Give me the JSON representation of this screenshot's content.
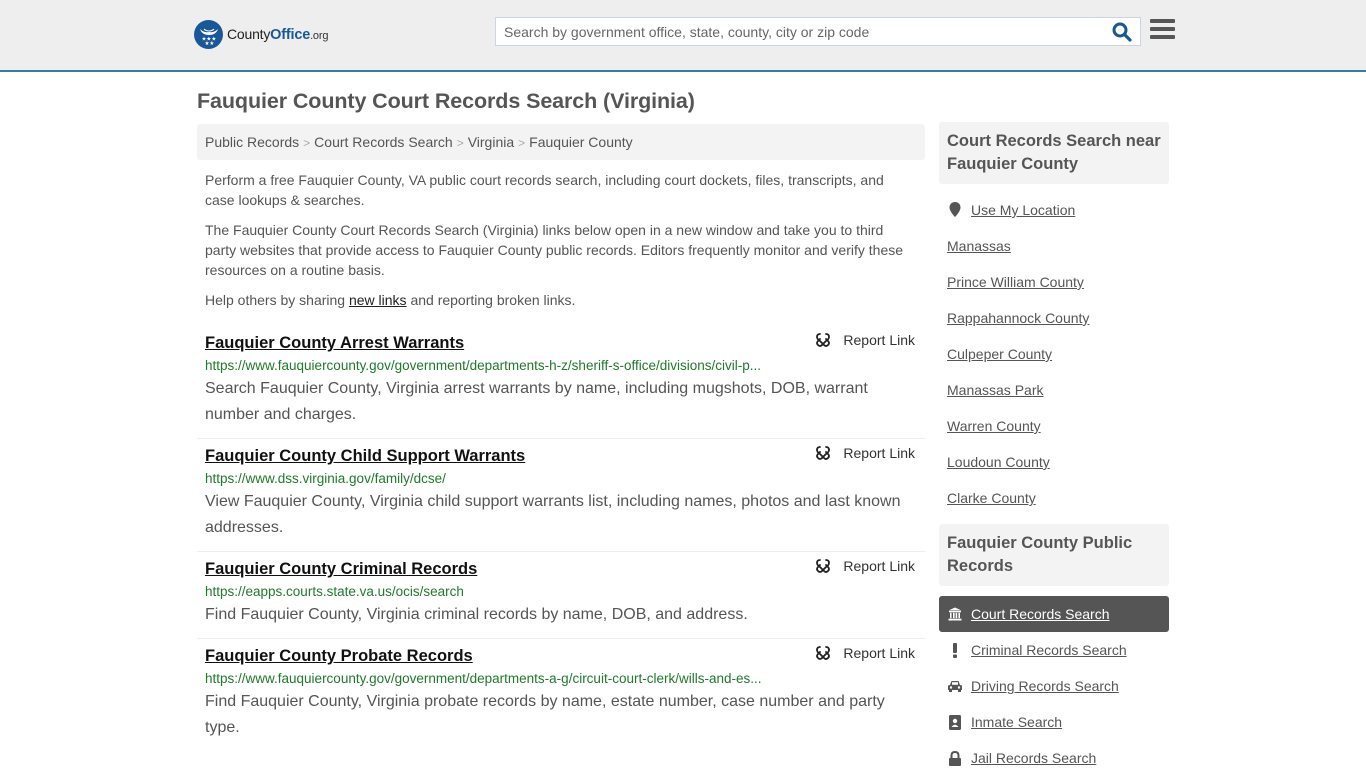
{
  "header": {
    "logo": {
      "name": "County",
      "accent": "Office",
      "tld": ".org"
    },
    "search": {
      "placeholder": "Search by government office, state, county, city or zip code",
      "value": ""
    },
    "colors": {
      "brand": "#1a5799",
      "header_bg": "#eeeeee",
      "header_border": "#3b78aa"
    }
  },
  "page": {
    "title": "Fauquier County Court Records Search (Virginia)",
    "breadcrumb": [
      "Public Records",
      "Court Records Search",
      "Virginia",
      "Fauquier County"
    ],
    "breadcrumb_separator": ">",
    "intro": {
      "p1": "Perform a free Fauquier County, VA public court records search, including court dockets, files, transcripts, and case lookups & searches.",
      "p2": "The Fauquier County Court Records Search (Virginia) links below open in a new window and take you to third party websites that provide access to Fauquier County public records. Editors frequently monitor and verify these resources on a routine basis.",
      "p3_before": "Help others by sharing ",
      "p3_link": "new links",
      "p3_after": " and reporting broken links."
    }
  },
  "results": [
    {
      "title": "Fauquier County Arrest Warrants",
      "url": "https://www.fauquiercounty.gov/government/departments-h-z/sheriff-s-office/divisions/civil-p...",
      "description": "Search Fauquier County, Virginia arrest warrants by name, including mugshots, DOB, warrant number and charges.",
      "report_label": "Report Link"
    },
    {
      "title": "Fauquier County Child Support Warrants",
      "url": "https://www.dss.virginia.gov/family/dcse/",
      "description": "View Fauquier County, Virginia child support warrants list, including names, photos and last known addresses.",
      "report_label": "Report Link"
    },
    {
      "title": "Fauquier County Criminal Records",
      "url": "https://eapps.courts.state.va.us/ocis/search",
      "description": "Find Fauquier County, Virginia criminal records by name, DOB, and address.",
      "report_label": "Report Link"
    },
    {
      "title": "Fauquier County Probate Records",
      "url": "https://www.fauquiercounty.gov/government/departments-a-g/circuit-court-clerk/wills-and-es...",
      "description": "Find Fauquier County, Virginia probate records by name, estate number, case number and party type.",
      "report_label": "Report Link"
    }
  ],
  "sidebar": {
    "nearby": {
      "heading": "Court Records Search near Fauquier County",
      "use_location": "Use My Location",
      "items": [
        "Manassas",
        "Prince William County",
        "Rappahannock County",
        "Culpeper County",
        "Manassas Park",
        "Warren County",
        "Loudoun County",
        "Clarke County"
      ]
    },
    "public_records": {
      "heading": "Fauquier County Public Records",
      "items": [
        {
          "label": "Court Records Search",
          "icon": "courthouse-icon",
          "active": true
        },
        {
          "label": "Criminal Records Search",
          "icon": "exclamation-icon",
          "active": false
        },
        {
          "label": "Driving Records Search",
          "icon": "car-icon",
          "active": false
        },
        {
          "label": "Inmate Search",
          "icon": "id-badge-icon",
          "active": false
        },
        {
          "label": "Jail Records Search",
          "icon": "lock-icon",
          "active": false
        }
      ]
    }
  }
}
